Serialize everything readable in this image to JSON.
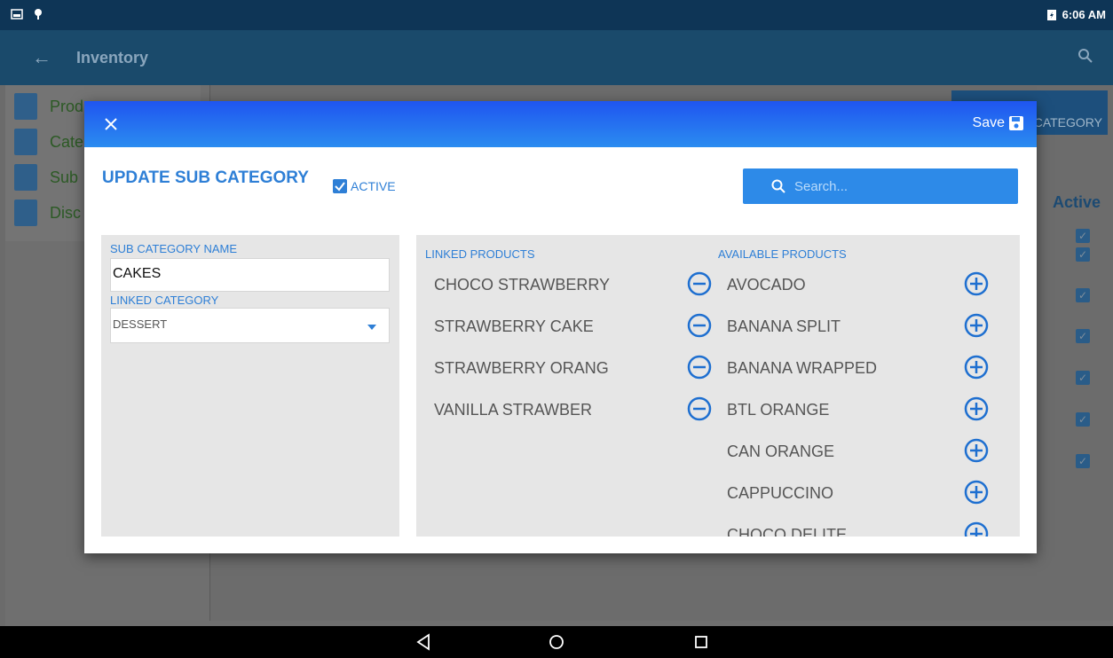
{
  "statusbar": {
    "time": "6:06 AM"
  },
  "appbar": {
    "title": "Inventory"
  },
  "background": {
    "side_menu": [
      "Product",
      "Category",
      "Sub Category",
      "Discount"
    ],
    "side_menu_visible": [
      "Prod",
      "Cate",
      "Sub",
      "Disc"
    ],
    "add_button_label": "CATEGORY",
    "active_header": "Active",
    "active_checks": 7
  },
  "dialog": {
    "save_label": "Save",
    "title": "UPDATE SUB CATEGORY",
    "active_label": "ACTIVE",
    "active_checked": true,
    "search_placeholder": "Search...",
    "sub_category_label": "SUB CATEGORY NAME",
    "sub_category_value": "CAKES",
    "linked_category_label": "LINKED CATEGORY",
    "linked_category_value": "DESSERT",
    "linked_products_header": "LINKED PRODUCTS",
    "available_products_header": "AVAILABLE PRODUCTS",
    "linked_products": [
      "CHOCO STRAWBERRY",
      "STRAWBERRY CAKE",
      "STRAWBERRY ORANG",
      "VANILLA STRAWBER"
    ],
    "available_products": [
      "AVOCADO",
      "BANANA SPLIT",
      "BANANA WRAPPED",
      "BTL ORANGE",
      "CAN ORANGE",
      "CAPPUCCINO",
      "CHOCO DELITE"
    ]
  },
  "colors": {
    "accent": "#2e7fd6",
    "header_top": "#1f55f0",
    "header_bottom": "#2b8cf0",
    "statusbar": "#0e3556"
  }
}
